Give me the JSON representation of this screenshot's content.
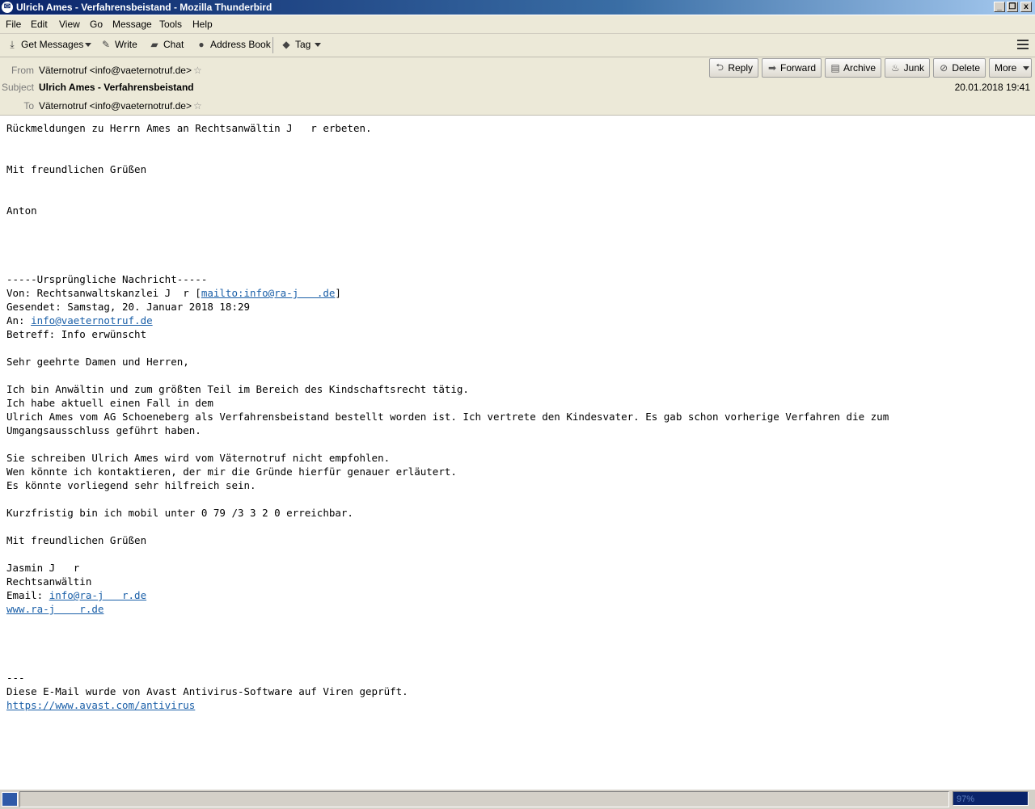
{
  "window": {
    "title": "Ulrich Ames - Verfahrensbeistand - Mozilla Thunderbird",
    "controls": [
      "_",
      "❐",
      "x"
    ]
  },
  "menu": [
    "File",
    "Edit",
    "View",
    "Go",
    "Message",
    "Tools",
    "Help"
  ],
  "toolbar": {
    "get_messages": "Get Messages",
    "write": "Write",
    "chat": "Chat",
    "address_book": "Address Book",
    "tag": "Tag"
  },
  "header": {
    "from_label": "From",
    "from_value": "Väternotruf <info@vaeternotruf.de>",
    "subject_label": "Subject",
    "subject_value": "Ulrich Ames - Verfahrensbeistand",
    "to_label": "To",
    "to_value": "Väternotruf <info@vaeternotruf.de>",
    "date": "20.01.2018 19:41"
  },
  "actions": {
    "reply": "Reply",
    "forward": "Forward",
    "archive": "Archive",
    "junk": "Junk",
    "delete": "Delete",
    "more": "More"
  },
  "body": {
    "l1": "Rückmeldungen zu Herrn Ames an Rechtsanwältin J   r erbeten.",
    "l2": "Mit freundlichen Grüßen",
    "l3": "Anton",
    "orig_sep": "-----Ursprüngliche Nachricht-----",
    "von_prefix": "Von: Rechtsanwaltskanzlei J  r [",
    "von_link": "mailto:info@ra-j   .de",
    "von_suffix": "]",
    "gesendet": "Gesendet: Samstag, 20. Januar 2018 18:29",
    "an_prefix": "An: ",
    "an_link": "info@vaeternotruf.de",
    "betreff": "Betreff: Info erwünscht",
    "greeting": "Sehr geehrte Damen und Herren,",
    "p1": "Ich bin Anwältin und zum größten Teil im Bereich des Kindschaftsrecht tätig.",
    "p2": "Ich habe aktuell einen Fall in dem",
    "p3": "Ulrich Ames vom AG Schoeneberg als Verfahrensbeistand bestellt worden ist. Ich vertrete den Kindesvater. Es gab schon vorherige Verfahren die zum",
    "p4": "Umgangsausschluss geführt haben.",
    "p5": "Sie schreiben Ulrich Ames wird vom Väternotruf nicht empfohlen.",
    "p6": "Wen könnte ich kontaktieren, der mir die Gründe hierfür genauer erläutert.",
    "p7": "Es könnte vorliegend sehr hilfreich sein.",
    "p8": "Kurzfristig bin ich mobil unter 0 79 /3 3 2 0 erreichbar.",
    "closing": "Mit freundlichen Grüßen",
    "sig_name": "Jasmin J   r",
    "sig_title": "Rechtsanwältin",
    "sig_email_prefix": "Email: ",
    "sig_email": "info@ra-j   r.de",
    "sig_web": "www.ra-j    r.de",
    "dashes": "---",
    "avast": "Diese E-Mail wurde von Avast Antivirus-Software auf Viren geprüft.",
    "avast_link": "https://www.avast.com/antivirus"
  },
  "status": {
    "progress": "97%"
  }
}
